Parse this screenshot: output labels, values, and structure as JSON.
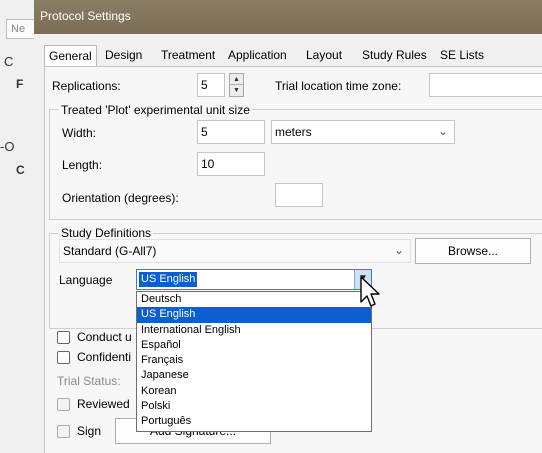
{
  "background": {
    "tab_label": "Ne",
    "side_texts": [
      "C",
      "F",
      "-O",
      "C"
    ]
  },
  "dialog": {
    "title": "Protocol Settings",
    "tabs": [
      {
        "label": "General",
        "active": true
      },
      {
        "label": "Design",
        "active": false
      },
      {
        "label": "Treatment",
        "active": false
      },
      {
        "label": "Application",
        "active": false
      },
      {
        "label": "Layout",
        "active": false
      },
      {
        "label": "Study Rules",
        "active": false
      },
      {
        "label": "SE Lists",
        "active": false
      }
    ]
  },
  "general": {
    "replications_label": "Replications:",
    "replications_value": "5",
    "timezone_label": "Trial location time zone:",
    "timezone_value": "",
    "plot_group_title": "Treated 'Plot' experimental unit size",
    "width_label": "Width:",
    "width_value": "5",
    "unit_value": "meters",
    "length_label": "Length:",
    "length_value": "10",
    "orientation_label": "Orientation (degrees):",
    "orientation_value": "",
    "study_group_title": "Study Definitions",
    "study_definition_value": "Standard (G-All7)",
    "browse_label": "Browse...",
    "language_label": "Language",
    "language_value": "US English",
    "language_options": [
      "Deutsch",
      "US English",
      "International English",
      "Español",
      "Français",
      "Japanese",
      "Korean",
      "Polski",
      "Português"
    ],
    "conduct_label": "Conduct u",
    "confidential_label": "Confidenti",
    "trial_status_label": "Trial Status:",
    "reviewed_label": "Reviewed",
    "sign_label": "Sign",
    "add_signature_label": "Add Signature..."
  },
  "colors": {
    "titlebar": "#7b6e55",
    "selection": "#0b5fd0",
    "dialog_bg": "#f0f0f0"
  }
}
